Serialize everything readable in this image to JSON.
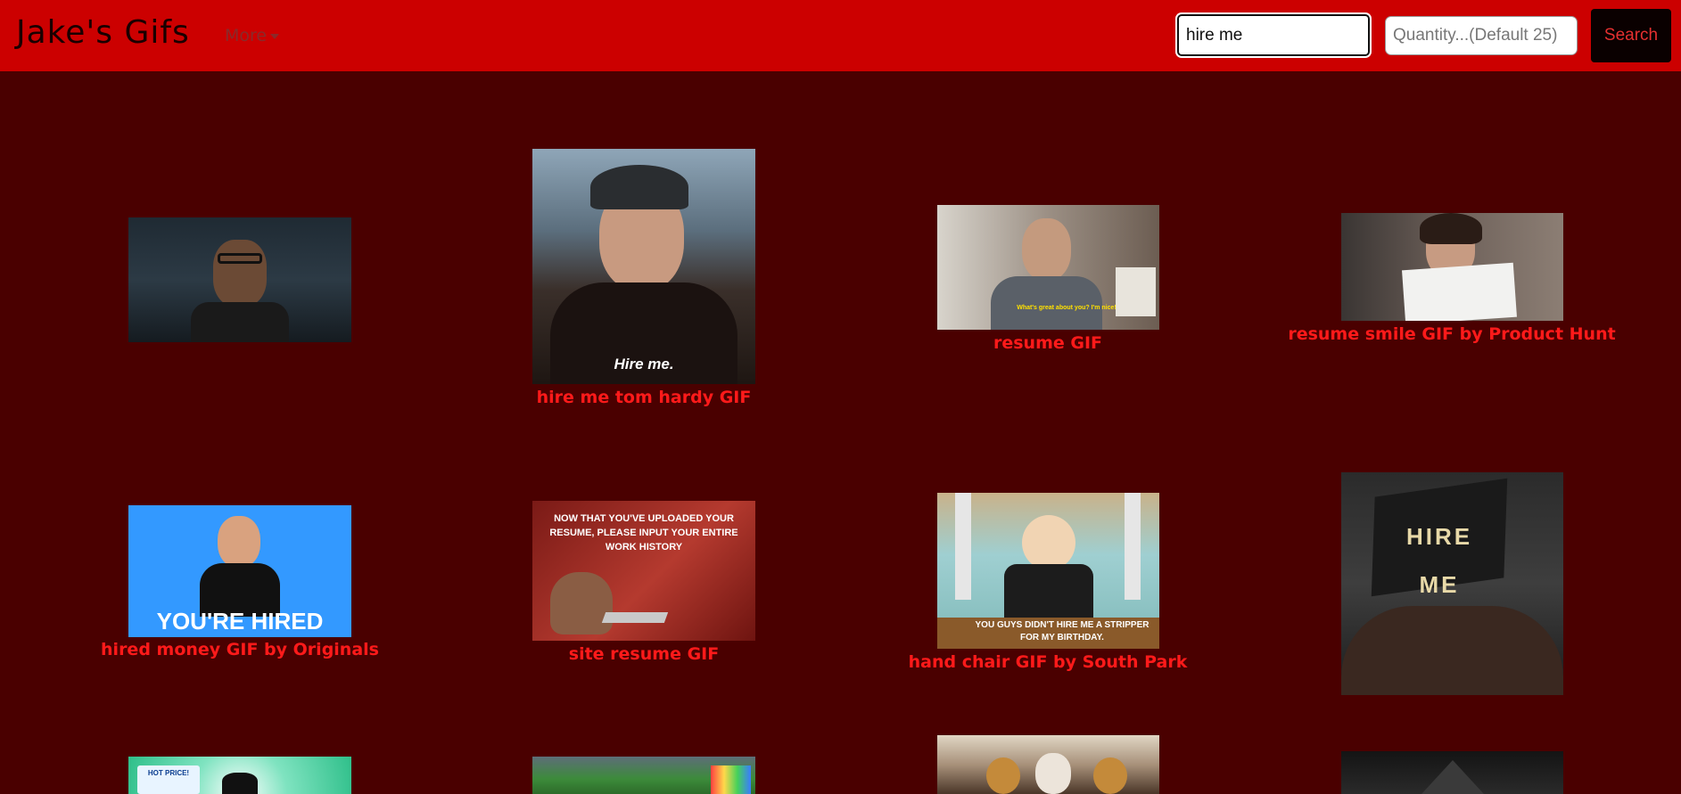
{
  "navbar": {
    "brand": "Jake's Gifs",
    "more_label": "More",
    "search_value": "hire me",
    "quantity_placeholder": "Quantity...(Default 25)",
    "search_button": "Search"
  },
  "gifs": [
    {
      "caption": "",
      "overlay": ""
    },
    {
      "caption": "hire me tom hardy GIF",
      "overlay": "Hire me."
    },
    {
      "caption": "resume GIF",
      "overlay": "What's great about you? I'm nice!"
    },
    {
      "caption": "resume smile GIF by Product Hunt",
      "overlay": ""
    },
    {
      "caption": "hired money GIF by Originals",
      "overlay": "YOU'RE HIRED"
    },
    {
      "caption": "site resume GIF",
      "overlay": "NOW THAT YOU'VE UPLOADED YOUR RESUME, PLEASE INPUT YOUR ENTIRE WORK HISTORY"
    },
    {
      "caption": "hand chair GIF by South Park",
      "overlay": "YOU GUYS DIDN'T HIRE ME A STRIPPER FOR MY BIRTHDAY."
    },
    {
      "caption": "",
      "overlay": "HIRE ME"
    },
    {
      "caption": "",
      "overlay": "HOT PRICE!"
    },
    {
      "caption": "",
      "overlay": ""
    },
    {
      "caption": "",
      "overlay": ""
    },
    {
      "caption": "",
      "overlay": ""
    }
  ]
}
